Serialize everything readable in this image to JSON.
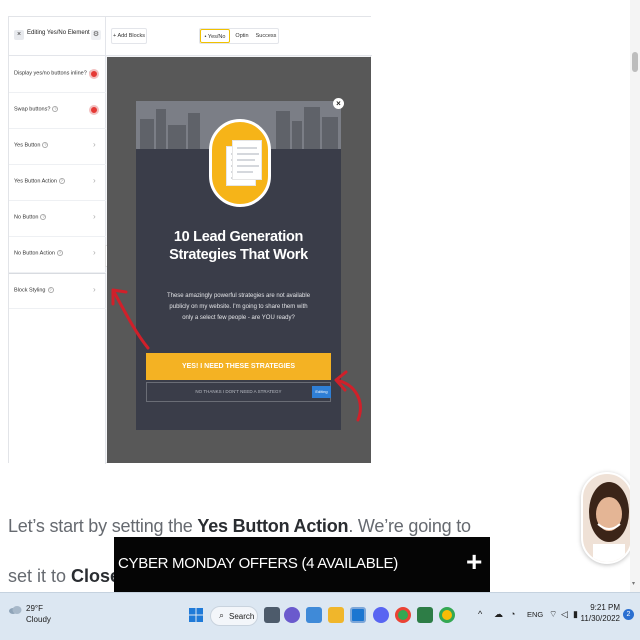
{
  "editor": {
    "sidebar_title": "Editing Yes/No Element",
    "close_glyph": "×",
    "settings_glyph": "⚙",
    "rows": [
      {
        "label": "Display yes/no buttons inline?",
        "control": "toggle"
      },
      {
        "label": "Swap buttons?",
        "control": "toggle"
      },
      {
        "label": "Yes Button",
        "control": "chevron"
      },
      {
        "label": "Yes Button Action",
        "control": "chevron"
      },
      {
        "label": "No Button",
        "control": "chevron"
      },
      {
        "label": "No Button Action",
        "control": "chevron"
      },
      {
        "label": "Block Styling",
        "control": "chevron"
      }
    ],
    "add_blocks": "+ Add Blocks",
    "tabs": [
      "• Yes/No",
      "Optin",
      "Success"
    ],
    "active_tab": "• Yes/No"
  },
  "popup": {
    "title": "10 Lead Generation Strategies That Work",
    "description": "These amazingly powerful strategies are not available publicly on my website. I'm going to share them with only a select few people - are YOU ready?",
    "yes_button": "YES! I NEED THESE STRATEGIES",
    "no_link": "NO THANKS I DON'T NEED A STRATEGY",
    "editing_tag": "Editing",
    "close_glyph": "×"
  },
  "article": {
    "line1_pre": "Let’s start by setting the ",
    "line1_bold": "Yes Button Action",
    "line1_post": ". We’re going to",
    "line2_pre": "set it to ",
    "line2_bold": "Close the"
  },
  "offer_bar": {
    "text": "CYBER MONDAY OFFERS (4 AVAILABLE)",
    "plus": "+"
  },
  "taskbar": {
    "temperature": "29°F",
    "condition": "Cloudy",
    "search_label": "Search",
    "language": "ENG",
    "time": "9:21 PM",
    "date": "11/30/2022",
    "notification_count": "2",
    "tray_chevron": "^"
  },
  "colors": {
    "popup_bg": "#3a3d49",
    "yes_button": "#f4b223",
    "book_circle": "#f6b418",
    "toggle_red": "#e53935",
    "annotation_arrow": "#d0202a",
    "offer_bar": "#050505"
  }
}
